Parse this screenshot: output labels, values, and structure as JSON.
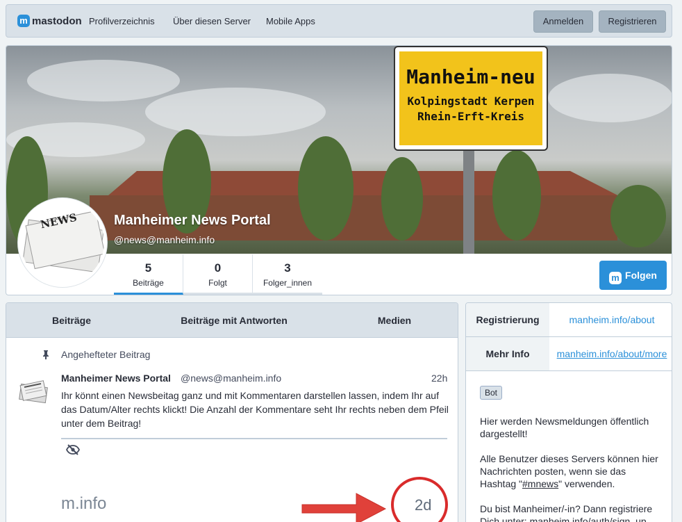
{
  "nav": {
    "logo": "mastodon",
    "logo_mark": "m",
    "links": [
      "Profilverzeichnis",
      "Über diesen Server",
      "Mobile Apps"
    ],
    "login": "Anmelden",
    "register": "Registrieren"
  },
  "profile": {
    "name": "Manheimer News Portal",
    "handle": "@news@manheim.info",
    "sign_line1": "Manheim-neu",
    "sign_line2": "Kolpingstadt Kerpen",
    "sign_line3": "Rhein-Erft-Kreis",
    "avatar_text": "NEWS",
    "counters": [
      {
        "num": "5",
        "label": "Beiträge"
      },
      {
        "num": "0",
        "label": "Folgt"
      },
      {
        "num": "3",
        "label": "Folger_innen"
      }
    ],
    "follow": "Folgen"
  },
  "feed": {
    "tabs": [
      "Beiträge",
      "Beiträge mit Antworten",
      "Medien"
    ],
    "pinned_label": "Angehefteter Beitrag",
    "status": {
      "name": "Manheimer News Portal",
      "handle": "@news@manheim.info",
      "time": "22h",
      "text": "Ihr könnt einen Newsbeitag ganz und mit Kommentaren darstellen lassen, indem Ihr auf das Datum/Alter rechts klickt! Die Anzahl der Kommentare seht Ihr rechts neben dem Pfeil unter dem Beitrag!",
      "ghost_text": "m.info",
      "age_label": "2d"
    }
  },
  "sidebar": {
    "rows": [
      {
        "key": "Registrierung",
        "value": "manheim.info/about"
      },
      {
        "key": "Mehr Info",
        "value": "manheim.info/about/more"
      }
    ],
    "bot_badge": "Bot",
    "bio_p1": "Hier werden Newsmeldungen öffentlich dargestellt!",
    "bio_p2_pre": "Alle Benutzer dieses Servers können hier Nachrichten posten, wenn sie das Hashtag \"",
    "bio_p2_tag": "#mnews",
    "bio_p2_post": "\" verwenden.",
    "bio_p3": "Du bist Manheimer/-in? Dann registriere Dich unter: manheim.info/auth/sign_up"
  },
  "colors": {
    "accent": "#2b90d9",
    "highlight_circle": "#d92b2b",
    "arrow": "#e0413a"
  }
}
